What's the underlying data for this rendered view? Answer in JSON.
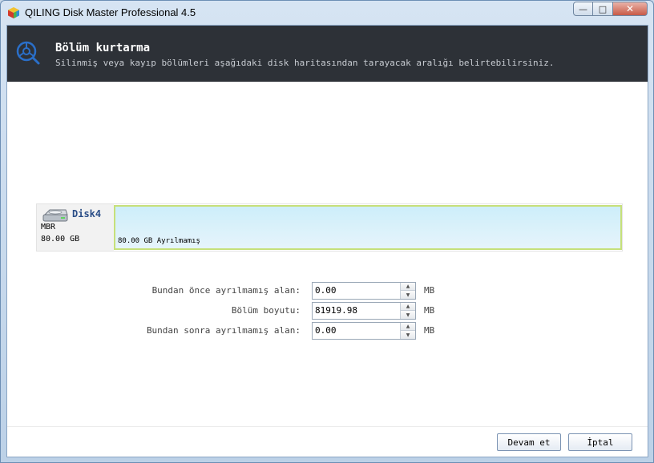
{
  "window": {
    "title": "QILING Disk Master Professional 4.5",
    "controls": {
      "minimize": "—",
      "maximize": "□",
      "close": "✕"
    }
  },
  "header": {
    "title": "Bölüm kurtarma",
    "description": "Silinmiş veya kayıp bölümleri aşağıdaki disk haritasından tarayacak aralığı belirtebilirsiniz.",
    "icon": "search-recover-icon"
  },
  "disk": {
    "name": "Disk4",
    "type": "MBR",
    "size": "80.00 GB",
    "icon": "hard-disk-icon",
    "partition_label": "80.00 GB Ayrılmamış"
  },
  "form": {
    "before": {
      "label": "Bundan önce ayrılmamış alan:",
      "value": "0.00",
      "unit": "MB"
    },
    "size": {
      "label": "Bölüm boyutu:",
      "value": "81919.98",
      "unit": "MB"
    },
    "after": {
      "label": "Bundan sonra ayrılmamış alan:",
      "value": "0.00",
      "unit": "MB"
    }
  },
  "buttons": {
    "next": "Devam et",
    "cancel": "İptal"
  },
  "colors": {
    "header_bg": "#2d3137",
    "accent_blue": "#2a6fc9",
    "partition_border": "#c6e07a",
    "partition_fill": "#cdeefa"
  }
}
